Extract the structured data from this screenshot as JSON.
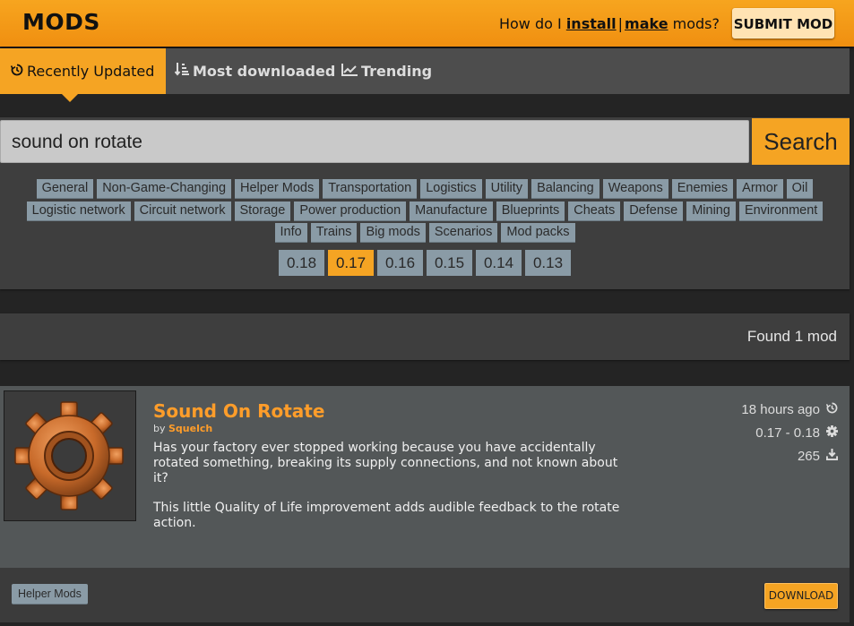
{
  "header": {
    "logo": "MODS",
    "howto_prefix": "How do I",
    "install_link": "install",
    "separator": "|",
    "make_link": "make",
    "howto_suffix": "mods?",
    "submit_label": "SUBMIT MOD"
  },
  "tabs": [
    {
      "label": "Recently Updated",
      "icon": "history-icon"
    },
    {
      "label": "Most downloaded",
      "icon": "sort-icon"
    },
    {
      "label": "Trending",
      "icon": "trend-chart-icon"
    }
  ],
  "search": {
    "value": "sound on rotate",
    "button_label": "Search"
  },
  "tags": {
    "row1": [
      "General",
      "Non-Game-Changing",
      "Helper Mods",
      "Transportation",
      "Logistics",
      "Utility",
      "Balancing",
      "Weapons",
      "Enemies",
      "Armor",
      "Oil"
    ],
    "row2": [
      "Logistic network",
      "Circuit network",
      "Storage",
      "Power production",
      "Manufacture",
      "Blueprints",
      "Cheats",
      "Defense",
      "Mining",
      "Environment"
    ],
    "row3": [
      "Info",
      "Trains",
      "Big mods",
      "Scenarios",
      "Mod packs"
    ]
  },
  "versions": [
    "0.18",
    "0.17",
    "0.16",
    "0.15",
    "0.14",
    "0.13"
  ],
  "active_version": "0.17",
  "found_text": "Found 1 mod",
  "mod": {
    "title": "Sound On Rotate",
    "by_label": "by",
    "author": "Squelch",
    "description": [
      "Has your factory ever stopped working because you have accidentally rotated something, breaking its supply connections, and not known about it?",
      "This little Quality of Life improvement adds audible feedback to the rotate action."
    ],
    "updated": "18 hours ago",
    "version_range": "0.17 - 0.18",
    "downloads": "265",
    "category_tag": "Helper Mods",
    "download_label": "DOWNLOAD"
  },
  "colors": {
    "accent": "#f5a423",
    "title_orange": "#ff9d2a",
    "tag_bg": "#8a9ba6"
  }
}
